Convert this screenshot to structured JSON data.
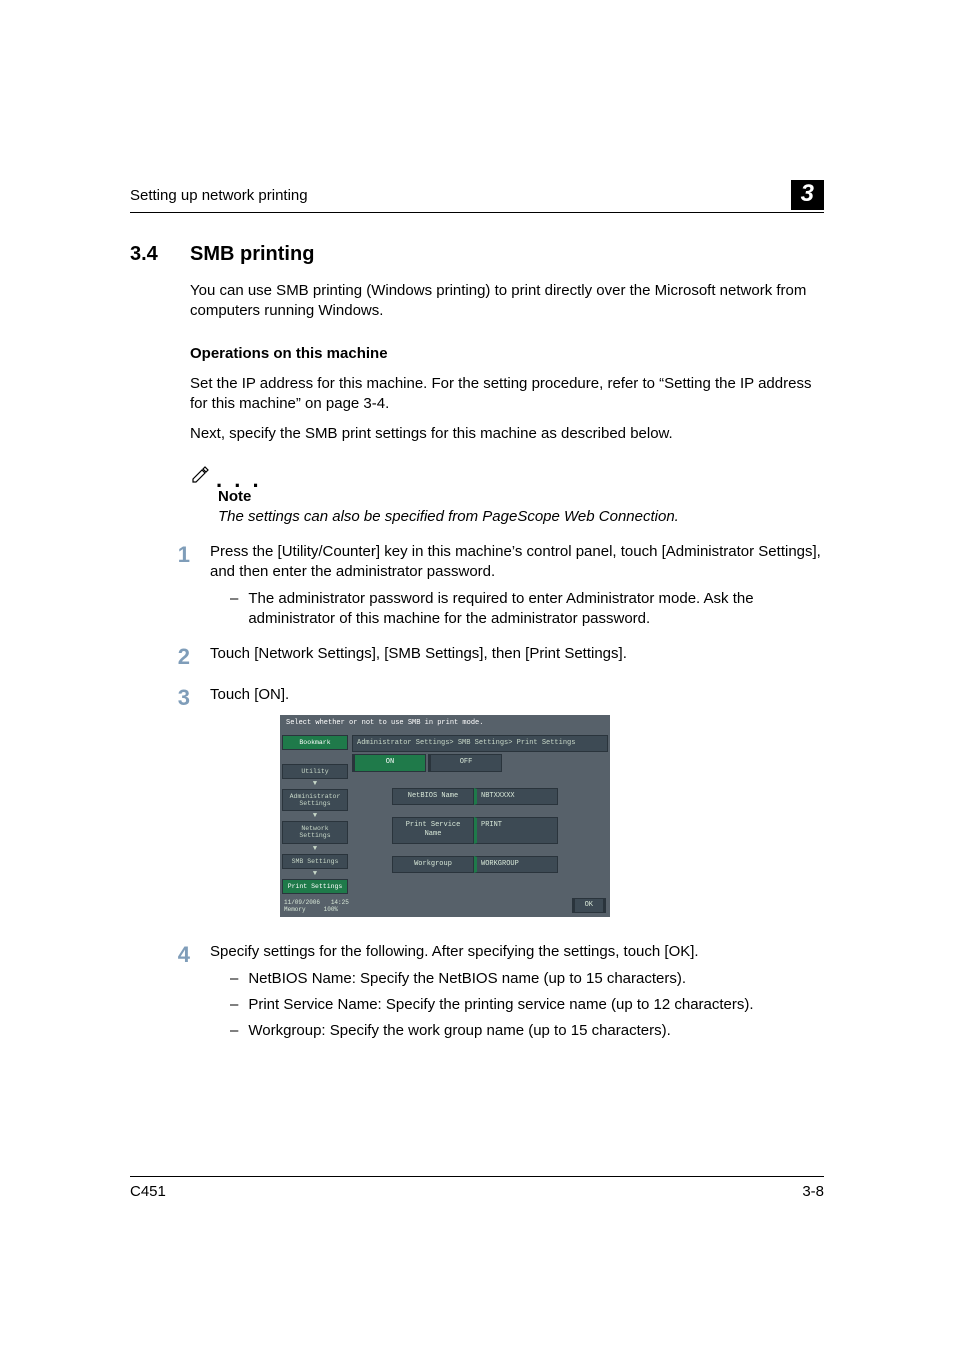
{
  "header": {
    "left": "Setting up network printing",
    "chapter": "3"
  },
  "section": {
    "num": "3.4",
    "title": "SMB printing"
  },
  "intro": "You can use SMB printing (Windows printing) to print directly over the Microsoft network from computers running Windows.",
  "subhead": "Operations on this machine",
  "p1": "Set the IP address for this machine. For the setting procedure, refer to “Setting the IP address for this machine” on page 3-4.",
  "p2": "Next, specify the SMB print settings for this machine as described below.",
  "note": {
    "dots": ". . .",
    "label": "Note",
    "text": "The settings can also be specified from PageScope Web Connection."
  },
  "steps": {
    "s1": {
      "num": "1",
      "text": "Press the [Utility/Counter] key in this machine’s control panel, touch [Administrator Settings], and then enter the administrator password.",
      "sub1": "The administrator password is required to enter Administrator mode. Ask the administrator of this machine for the administrator password."
    },
    "s2": {
      "num": "2",
      "text": "Touch [Network Settings], [SMB Settings], then [Print Settings]."
    },
    "s3": {
      "num": "3",
      "text": "Touch [ON]."
    },
    "s4": {
      "num": "4",
      "text": "Specify settings for the following. After specifying the settings, touch [OK].",
      "sub1": "NetBIOS Name: Specify the NetBIOS name (up to 15 characters).",
      "sub2": "Print Service Name: Specify the printing service name (up to 12 characters).",
      "sub3": "Workgroup: Specify the work group name (up to 15 characters)."
    }
  },
  "screen": {
    "instruction": "Select whether or not to use SMB in print mode.",
    "path": "Administrator Settings> SMB Settings> Print Settings",
    "left": {
      "bookmark": "Bookmark",
      "utility": "Utility",
      "admin": "Administrator\nSettings",
      "network": "Network\nSettings",
      "smb": "SMB Settings",
      "print": "Print Settings"
    },
    "toggle": {
      "on": "ON",
      "off": "OFF"
    },
    "fields": {
      "netbios_label": "NetBIOS Name",
      "netbios_val": "NBTXXXXX",
      "psn_label": "Print Service Name",
      "psn_val": "PRINT",
      "wg_label": "Workgroup",
      "wg_val": "WORKGROUP"
    },
    "status": {
      "date": "11/09/2006",
      "time": "14:25",
      "mem": "Memory",
      "mempct": "100%"
    },
    "ok": "OK"
  },
  "footer": {
    "left": "C451",
    "right": "3-8"
  }
}
